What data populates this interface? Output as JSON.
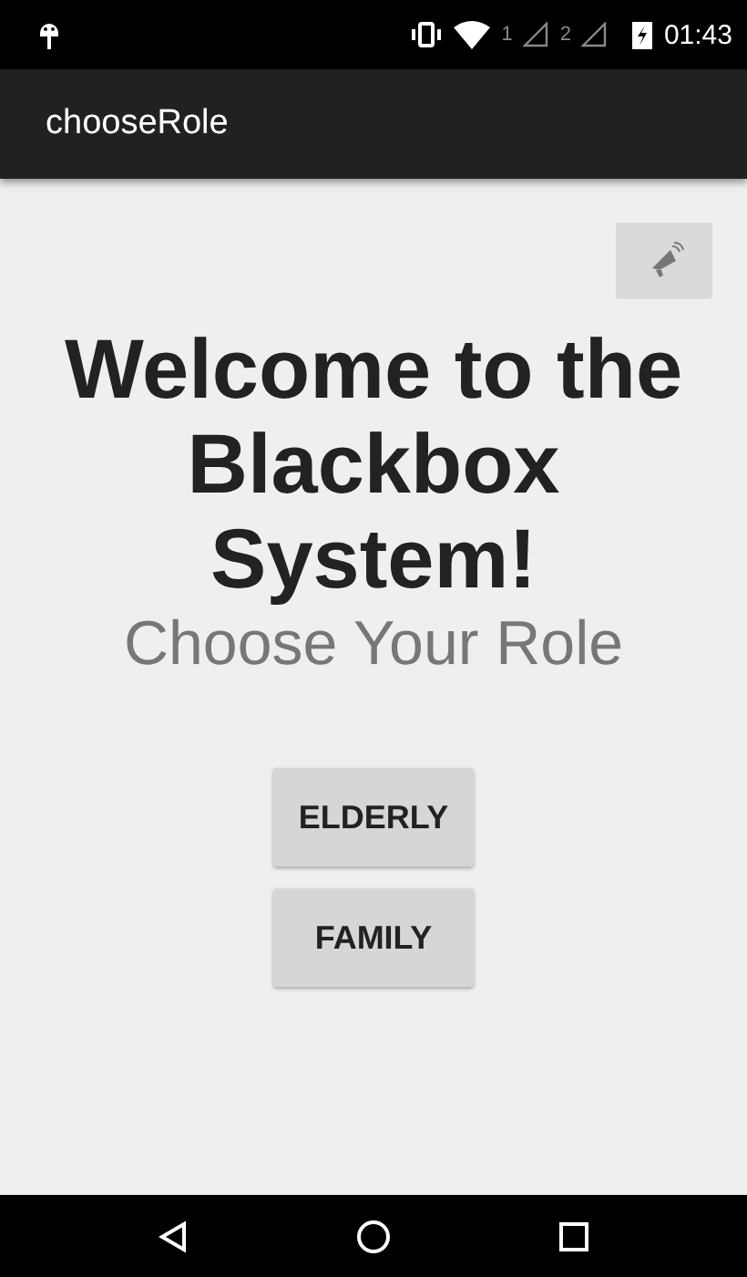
{
  "status_bar": {
    "sim_1": "1",
    "sim_2": "2",
    "time": "01:43"
  },
  "app_bar": {
    "title": "chooseRole"
  },
  "heading": "Welcome to the Blackbox System!",
  "subheading": "Choose Your Role",
  "buttons": [
    "ELDERLY",
    "FAMILY"
  ]
}
